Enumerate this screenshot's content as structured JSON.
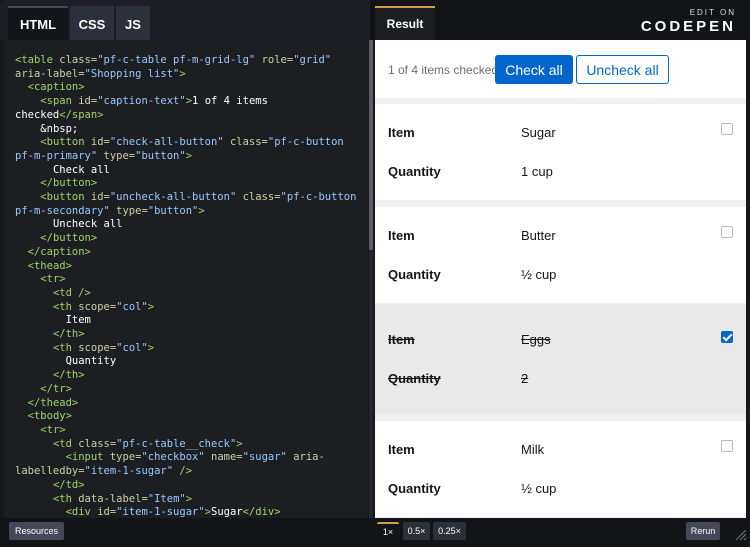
{
  "editor_tabs": [
    "HTML",
    "CSS",
    "JS"
  ],
  "result_tab": "Result",
  "logo": {
    "top": "EDIT ON",
    "bottom": "CODEPEN"
  },
  "code_lines": [
    [
      [
        "tg",
        "<table "
      ],
      [
        "at",
        "class="
      ],
      [
        "st",
        "\"pf-c-table pf-m-grid-lg\" "
      ],
      [
        "at",
        "role="
      ],
      [
        "st",
        "\"grid\""
      ]
    ],
    [
      [
        "at",
        "aria-label="
      ],
      [
        "st",
        "\"Shopping list\""
      ],
      [
        "tg",
        ">"
      ]
    ],
    [
      [
        "tx",
        "  "
      ],
      [
        "tg",
        "<caption>"
      ]
    ],
    [
      [
        "tx",
        "    "
      ],
      [
        "tg",
        "<span "
      ],
      [
        "at",
        "id="
      ],
      [
        "st",
        "\"caption-text\""
      ],
      [
        "tg",
        ">"
      ],
      [
        "tx",
        "1 of 4 items"
      ]
    ],
    [
      [
        "tx",
        "checked"
      ],
      [
        "tg",
        "</span>"
      ]
    ],
    [
      [
        "tx",
        "    &nbsp;"
      ]
    ],
    [
      [
        "tx",
        "    "
      ],
      [
        "tg",
        "<button "
      ],
      [
        "at",
        "id="
      ],
      [
        "st",
        "\"check-all-button\" "
      ],
      [
        "at",
        "class="
      ],
      [
        "st",
        "\"pf-c-button"
      ]
    ],
    [
      [
        "st",
        "pf-m-primary\" "
      ],
      [
        "at",
        "type="
      ],
      [
        "st",
        "\"button\""
      ],
      [
        "tg",
        ">"
      ]
    ],
    [
      [
        "tx",
        "      Check all"
      ]
    ],
    [
      [
        "tx",
        "    "
      ],
      [
        "tg",
        "</button>"
      ]
    ],
    [
      [
        "tx",
        "    "
      ],
      [
        "tg",
        "<button "
      ],
      [
        "at",
        "id="
      ],
      [
        "st",
        "\"uncheck-all-button\" "
      ],
      [
        "at",
        "class="
      ],
      [
        "st",
        "\"pf-c-button"
      ]
    ],
    [
      [
        "st",
        "pf-m-secondary\" "
      ],
      [
        "at",
        "type="
      ],
      [
        "st",
        "\"button\""
      ],
      [
        "tg",
        ">"
      ]
    ],
    [
      [
        "tx",
        "      Uncheck all"
      ]
    ],
    [
      [
        "tx",
        "    "
      ],
      [
        "tg",
        "</button>"
      ]
    ],
    [
      [
        "tx",
        "  "
      ],
      [
        "tg",
        "</caption>"
      ]
    ],
    [
      [
        "tx",
        "  "
      ],
      [
        "tg",
        "<thead>"
      ]
    ],
    [
      [
        "tx",
        "    "
      ],
      [
        "tg",
        "<tr>"
      ]
    ],
    [
      [
        "tx",
        "      "
      ],
      [
        "tg",
        "<td />"
      ]
    ],
    [
      [
        "tx",
        "      "
      ],
      [
        "tg",
        "<th "
      ],
      [
        "at",
        "scope="
      ],
      [
        "st",
        "\"col\""
      ],
      [
        "tg",
        ">"
      ]
    ],
    [
      [
        "tx",
        "        Item"
      ]
    ],
    [
      [
        "tx",
        "      "
      ],
      [
        "tg",
        "</th>"
      ]
    ],
    [
      [
        "tx",
        "      "
      ],
      [
        "tg",
        "<th "
      ],
      [
        "at",
        "scope="
      ],
      [
        "st",
        "\"col\""
      ],
      [
        "tg",
        ">"
      ]
    ],
    [
      [
        "tx",
        "        Quantity"
      ]
    ],
    [
      [
        "tx",
        "      "
      ],
      [
        "tg",
        "</th>"
      ]
    ],
    [
      [
        "tx",
        "    "
      ],
      [
        "tg",
        "</tr>"
      ]
    ],
    [
      [
        "tx",
        "  "
      ],
      [
        "tg",
        "</thead>"
      ]
    ],
    [
      [
        "tx",
        "  "
      ],
      [
        "tg",
        "<tbody>"
      ]
    ],
    [
      [
        "tx",
        "    "
      ],
      [
        "tg",
        "<tr>"
      ]
    ],
    [
      [
        "tx",
        "      "
      ],
      [
        "tg",
        "<td "
      ],
      [
        "at",
        "class="
      ],
      [
        "st",
        "\"pf-c-table__check\""
      ],
      [
        "tg",
        ">"
      ]
    ],
    [
      [
        "tx",
        "        "
      ],
      [
        "tg",
        "<input "
      ],
      [
        "at",
        "type="
      ],
      [
        "st",
        "\"checkbox\" "
      ],
      [
        "at",
        "name="
      ],
      [
        "st",
        "\"sugar\" "
      ],
      [
        "at",
        "aria-"
      ]
    ],
    [
      [
        "at",
        "labelledby="
      ],
      [
        "st",
        "\"item-1-sugar\" "
      ],
      [
        "tg",
        "/>"
      ]
    ],
    [
      [
        "tx",
        "      "
      ],
      [
        "tg",
        "</td>"
      ]
    ],
    [
      [
        "tx",
        "      "
      ],
      [
        "tg",
        "<th "
      ],
      [
        "at",
        "data-label="
      ],
      [
        "st",
        "\"Item\""
      ],
      [
        "tg",
        ">"
      ]
    ],
    [
      [
        "tx",
        "        "
      ],
      [
        "tg",
        "<div "
      ],
      [
        "at",
        "id="
      ],
      [
        "st",
        "\"item-1-sugar\""
      ],
      [
        "tg",
        ">"
      ],
      [
        "tx",
        "Sugar"
      ],
      [
        "tg",
        "</div>"
      ]
    ]
  ],
  "caption": {
    "text": "1 of 4 items checked",
    "check_all": "Check all",
    "uncheck_all": "Uncheck all"
  },
  "rows": [
    {
      "item_label": "Item",
      "item": "Sugar",
      "qty_label": "Quantity",
      "qty": "1 cup",
      "checked": false
    },
    {
      "item_label": "Item",
      "item": "Butter",
      "qty_label": "Quantity",
      "qty": "½ cup",
      "checked": false
    },
    {
      "item_label": "Item",
      "item": "Eggs",
      "qty_label": "Quantity",
      "qty": "2",
      "checked": true
    },
    {
      "item_label": "Item",
      "item": "Milk",
      "qty_label": "Quantity",
      "qty": "½ cup",
      "checked": false
    }
  ],
  "bottom": {
    "resources": "Resources",
    "zooms": [
      "1×",
      "0.5×",
      "0.25×"
    ],
    "rerun": "Rerun"
  }
}
